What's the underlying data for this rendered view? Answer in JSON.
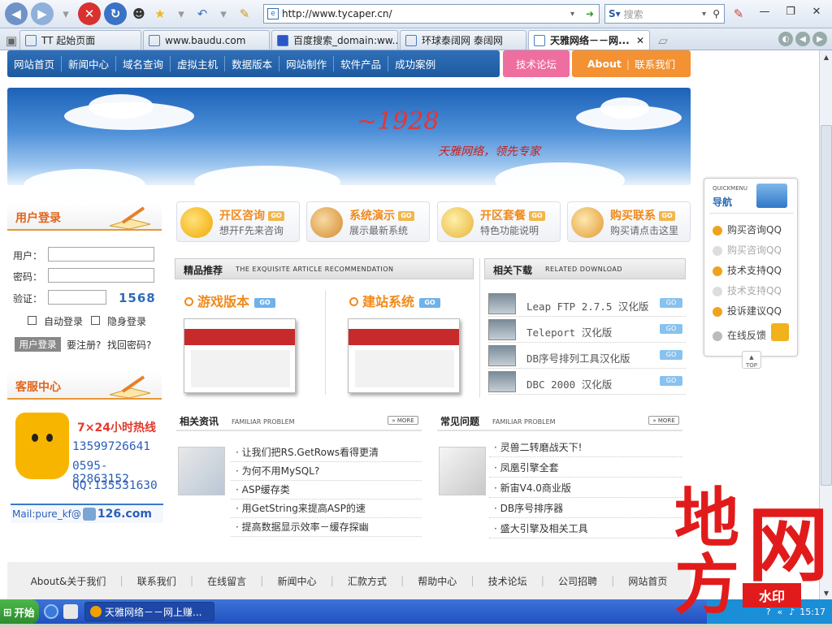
{
  "browser": {
    "address": "http://www.tycaper.cn/",
    "search_placeholder": "搜索",
    "tabs": [
      {
        "label": "TT 起始页面"
      },
      {
        "label": "www.baudu.com"
      },
      {
        "label": "百度搜索_domain:ww..."
      },
      {
        "label": "环球泰阔网 泰阔网"
      },
      {
        "label": "天雅网络－－网..."
      }
    ]
  },
  "nav": {
    "items": [
      "网站首页",
      "新闻中心",
      "域名查询",
      "虚拟主机",
      "数据版本",
      "网站制作",
      "软件产品",
      "成功案例"
    ],
    "forum": "技术论坛",
    "about": "About",
    "contact": "联系我们"
  },
  "banner": {
    "logo": "~1928",
    "slogan": "天雅网络，领先专家"
  },
  "login": {
    "title": "用户登录",
    "user_label": "用户：",
    "pass_label": "密码：",
    "verify_label": "验证：",
    "captcha": "1568",
    "auto_login": "自动登录",
    "hidden_login": "隐身登录",
    "login_button": "用户登录",
    "register": "要注册?",
    "forgot": "找回密码?"
  },
  "service": {
    "title": "客服中心",
    "hotline": "7×24小时热线",
    "phone1": "13599726641",
    "phone2": "0595-82863152",
    "qq": "QQ:135531630",
    "mail": "Mail:pure_kf@",
    "mail_domain": "126.com"
  },
  "quick": [
    {
      "title": "开区咨询",
      "sub": "想开F先来咨询"
    },
    {
      "title": "系统演示",
      "sub": "展示最新系统"
    },
    {
      "title": "开区套餐",
      "sub": "特色功能说明"
    },
    {
      "title": "购买联系",
      "sub": "购买请点击这里"
    }
  ],
  "go_label": "GO",
  "recommend": {
    "title": "精品推荐",
    "en": "THE EXQUISITE ARTICLE RECOMMENDATION",
    "prod1": "游戏版本",
    "prod2": "建站系统",
    "go": "GO"
  },
  "downloads": {
    "title": "相关下载",
    "en": "RELATED DOWNLOAD",
    "items": [
      "Leap FTP 2.7.5 汉化版",
      "Teleport 汉化版",
      "DB序号排列工具汉化版",
      "DBC 2000 汉化版"
    ],
    "go": "GO"
  },
  "news": {
    "title": "相关资讯",
    "en": "FAMILIAR PROBLEM",
    "more": "MORE",
    "items": [
      "让我们把RS.GetRows看得更清",
      "为何不用MySQL?",
      "ASP缓存类",
      "用GetString来提高ASP的速",
      "提高数据显示效率－缓存探幽"
    ]
  },
  "faq": {
    "title": "常见问题",
    "en": "FAMILIAR PROBLEM",
    "more": "MORE",
    "items": [
      "灵兽二转磨战天下!",
      "凤凰引擎全套",
      "新宙V4.0商业版",
      "DB序号排序器",
      "盛大引擎及相关工具"
    ]
  },
  "footer": [
    "About&关于我们",
    "联系我们",
    "在线留言",
    "新闻中心",
    "汇款方式",
    "帮助中心",
    "技术论坛",
    "公司招聘",
    "网站首页"
  ],
  "quickmenu": {
    "en": "QUICKMENU",
    "title": "导航",
    "items": [
      "购买咨询QQ",
      "购买咨询QQ",
      "技术支持QQ",
      "技术支持QQ",
      "投诉建议QQ"
    ],
    "feedback": "在线反馈",
    "top": "TOP"
  },
  "taskbar": {
    "start": "开始",
    "task": "天雅网络－－网上赚...",
    "time": "15:17"
  },
  "watermark": {
    "c1": "地",
    "c2": "方",
    "c3": "网",
    "stamp": "水印"
  }
}
